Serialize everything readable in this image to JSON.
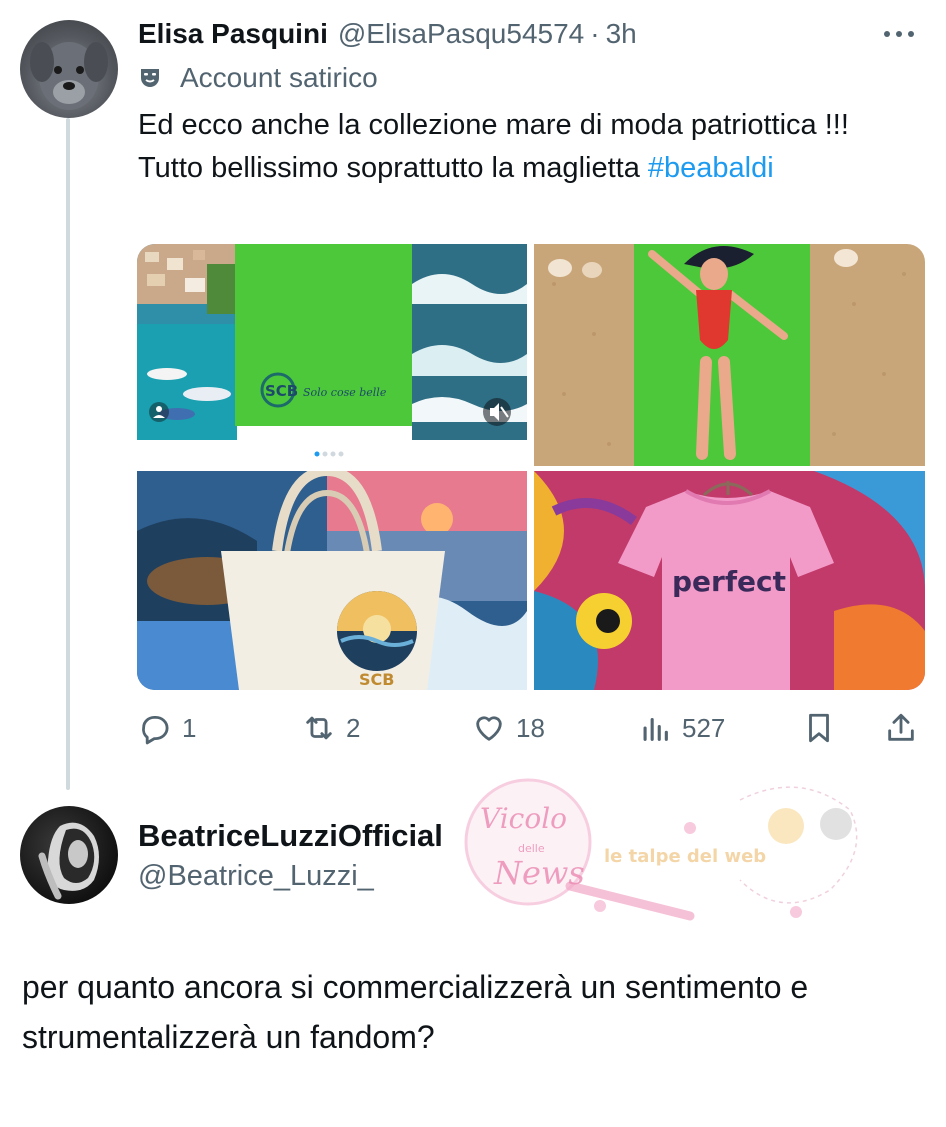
{
  "tweet": {
    "author_name": "Elisa Pasquini",
    "author_handle": "@ElisaPasqu54574",
    "separator": "·",
    "time": "3h",
    "label_text": "Account satirico",
    "text_plain": "Ed ecco anche la collezione mare di moda patriottica  !!! Tutto  bellissimo soprattutto la maglietta ",
    "hashtag": "#beabaldi",
    "media": {
      "tl_brand": "Solo cose belle",
      "bl_brand": "SCB",
      "br_shirt": "perfect"
    },
    "actions": {
      "replies": "1",
      "reposts": "2",
      "likes": "18",
      "views": "527"
    },
    "icons": [
      "more-icon",
      "satire-mask-icon",
      "reply-icon",
      "repost-icon",
      "like-icon",
      "views-icon",
      "bookmark-icon",
      "share-icon",
      "mute-icon"
    ]
  },
  "reply": {
    "author_name": "BeatriceLuzziOfficial",
    "author_handle": "@Beatrice_Luzzi_",
    "text": "per quanto ancora si commercializzerà un sentimento e strumentalizzerà un fandom?"
  },
  "watermark": {
    "line1": "Vicolo",
    "line2": "delle",
    "line3": "News",
    "tagline": "le talpe del web"
  },
  "colors": {
    "link": "#1d9bf0",
    "secondary": "#536471",
    "primary_text": "#0f1419",
    "towel_green": "#4cc83a",
    "shirt_pink": "#f29bc9"
  }
}
